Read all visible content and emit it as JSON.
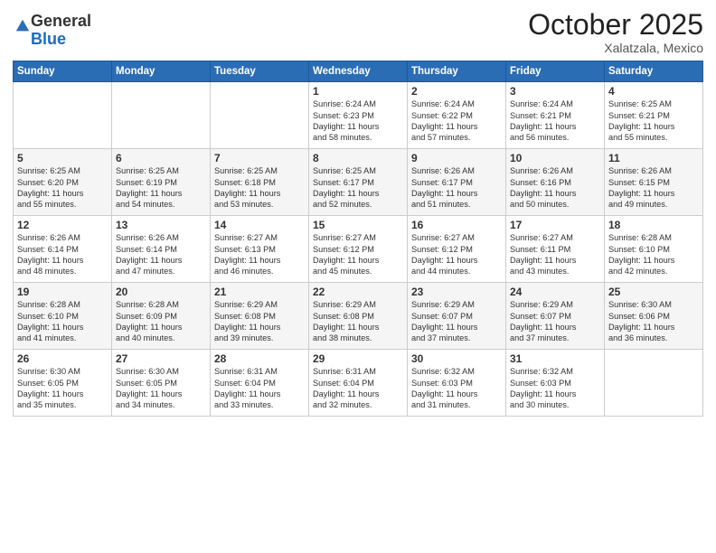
{
  "header": {
    "logo_general": "General",
    "logo_blue": "Blue",
    "month": "October 2025",
    "location": "Xalatzala, Mexico"
  },
  "days_of_week": [
    "Sunday",
    "Monday",
    "Tuesday",
    "Wednesday",
    "Thursday",
    "Friday",
    "Saturday"
  ],
  "weeks": [
    [
      {
        "day": "",
        "info": ""
      },
      {
        "day": "",
        "info": ""
      },
      {
        "day": "",
        "info": ""
      },
      {
        "day": "1",
        "info": "Sunrise: 6:24 AM\nSunset: 6:23 PM\nDaylight: 11 hours\nand 58 minutes."
      },
      {
        "day": "2",
        "info": "Sunrise: 6:24 AM\nSunset: 6:22 PM\nDaylight: 11 hours\nand 57 minutes."
      },
      {
        "day": "3",
        "info": "Sunrise: 6:24 AM\nSunset: 6:21 PM\nDaylight: 11 hours\nand 56 minutes."
      },
      {
        "day": "4",
        "info": "Sunrise: 6:25 AM\nSunset: 6:21 PM\nDaylight: 11 hours\nand 55 minutes."
      }
    ],
    [
      {
        "day": "5",
        "info": "Sunrise: 6:25 AM\nSunset: 6:20 PM\nDaylight: 11 hours\nand 55 minutes."
      },
      {
        "day": "6",
        "info": "Sunrise: 6:25 AM\nSunset: 6:19 PM\nDaylight: 11 hours\nand 54 minutes."
      },
      {
        "day": "7",
        "info": "Sunrise: 6:25 AM\nSunset: 6:18 PM\nDaylight: 11 hours\nand 53 minutes."
      },
      {
        "day": "8",
        "info": "Sunrise: 6:25 AM\nSunset: 6:17 PM\nDaylight: 11 hours\nand 52 minutes."
      },
      {
        "day": "9",
        "info": "Sunrise: 6:26 AM\nSunset: 6:17 PM\nDaylight: 11 hours\nand 51 minutes."
      },
      {
        "day": "10",
        "info": "Sunrise: 6:26 AM\nSunset: 6:16 PM\nDaylight: 11 hours\nand 50 minutes."
      },
      {
        "day": "11",
        "info": "Sunrise: 6:26 AM\nSunset: 6:15 PM\nDaylight: 11 hours\nand 49 minutes."
      }
    ],
    [
      {
        "day": "12",
        "info": "Sunrise: 6:26 AM\nSunset: 6:14 PM\nDaylight: 11 hours\nand 48 minutes."
      },
      {
        "day": "13",
        "info": "Sunrise: 6:26 AM\nSunset: 6:14 PM\nDaylight: 11 hours\nand 47 minutes."
      },
      {
        "day": "14",
        "info": "Sunrise: 6:27 AM\nSunset: 6:13 PM\nDaylight: 11 hours\nand 46 minutes."
      },
      {
        "day": "15",
        "info": "Sunrise: 6:27 AM\nSunset: 6:12 PM\nDaylight: 11 hours\nand 45 minutes."
      },
      {
        "day": "16",
        "info": "Sunrise: 6:27 AM\nSunset: 6:12 PM\nDaylight: 11 hours\nand 44 minutes."
      },
      {
        "day": "17",
        "info": "Sunrise: 6:27 AM\nSunset: 6:11 PM\nDaylight: 11 hours\nand 43 minutes."
      },
      {
        "day": "18",
        "info": "Sunrise: 6:28 AM\nSunset: 6:10 PM\nDaylight: 11 hours\nand 42 minutes."
      }
    ],
    [
      {
        "day": "19",
        "info": "Sunrise: 6:28 AM\nSunset: 6:10 PM\nDaylight: 11 hours\nand 41 minutes."
      },
      {
        "day": "20",
        "info": "Sunrise: 6:28 AM\nSunset: 6:09 PM\nDaylight: 11 hours\nand 40 minutes."
      },
      {
        "day": "21",
        "info": "Sunrise: 6:29 AM\nSunset: 6:08 PM\nDaylight: 11 hours\nand 39 minutes."
      },
      {
        "day": "22",
        "info": "Sunrise: 6:29 AM\nSunset: 6:08 PM\nDaylight: 11 hours\nand 38 minutes."
      },
      {
        "day": "23",
        "info": "Sunrise: 6:29 AM\nSunset: 6:07 PM\nDaylight: 11 hours\nand 37 minutes."
      },
      {
        "day": "24",
        "info": "Sunrise: 6:29 AM\nSunset: 6:07 PM\nDaylight: 11 hours\nand 37 minutes."
      },
      {
        "day": "25",
        "info": "Sunrise: 6:30 AM\nSunset: 6:06 PM\nDaylight: 11 hours\nand 36 minutes."
      }
    ],
    [
      {
        "day": "26",
        "info": "Sunrise: 6:30 AM\nSunset: 6:05 PM\nDaylight: 11 hours\nand 35 minutes."
      },
      {
        "day": "27",
        "info": "Sunrise: 6:30 AM\nSunset: 6:05 PM\nDaylight: 11 hours\nand 34 minutes."
      },
      {
        "day": "28",
        "info": "Sunrise: 6:31 AM\nSunset: 6:04 PM\nDaylight: 11 hours\nand 33 minutes."
      },
      {
        "day": "29",
        "info": "Sunrise: 6:31 AM\nSunset: 6:04 PM\nDaylight: 11 hours\nand 32 minutes."
      },
      {
        "day": "30",
        "info": "Sunrise: 6:32 AM\nSunset: 6:03 PM\nDaylight: 11 hours\nand 31 minutes."
      },
      {
        "day": "31",
        "info": "Sunrise: 6:32 AM\nSunset: 6:03 PM\nDaylight: 11 hours\nand 30 minutes."
      },
      {
        "day": "",
        "info": ""
      }
    ]
  ]
}
